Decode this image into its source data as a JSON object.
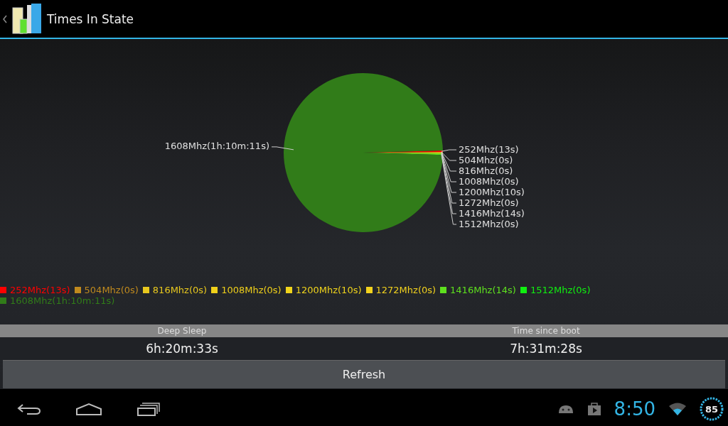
{
  "action_bar": {
    "title": "Times In State"
  },
  "chart": {
    "chart_data": {
      "type": "pie",
      "categories": [
        "252Mhz(13s)",
        "504Mhz(0s)",
        "816Mhz(0s)",
        "1008Mhz(0s)",
        "1200Mhz(10s)",
        "1272Mhz(0s)",
        "1416Mhz(14s)",
        "1512Mhz(0s)",
        "1608Mhz(1h:10m:11s)"
      ],
      "values": [
        13,
        0,
        0,
        0,
        10,
        0,
        14,
        0,
        4211
      ]
    },
    "legend": [
      {
        "label": "252Mhz(13s)",
        "color": "#ff0000"
      },
      {
        "label": "504Mhz(0s)",
        "color": "#c08a1e"
      },
      {
        "label": "816Mhz(0s)",
        "color": "#e8c81e"
      },
      {
        "label": "1008Mhz(0s)",
        "color": "#f0d01a"
      },
      {
        "label": "1200Mhz(10s)",
        "color": "#f0d41c"
      },
      {
        "label": "1272Mhz(0s)",
        "color": "#f2d21e"
      },
      {
        "label": "1416Mhz(14s)",
        "color": "#5ee01e"
      },
      {
        "label": "1512Mhz(0s)",
        "color": "#10f010"
      },
      {
        "label": "1608Mhz(1h:10m:11s)",
        "color": "#317c19"
      }
    ]
  },
  "stats": [
    {
      "label": "Deep Sleep",
      "value": "6h:20m:33s"
    },
    {
      "label": "Time since boot",
      "value": "7h:31m:28s"
    }
  ],
  "refresh_button": "Refresh",
  "status_bar": {
    "time": "8:50",
    "battery": "85"
  }
}
